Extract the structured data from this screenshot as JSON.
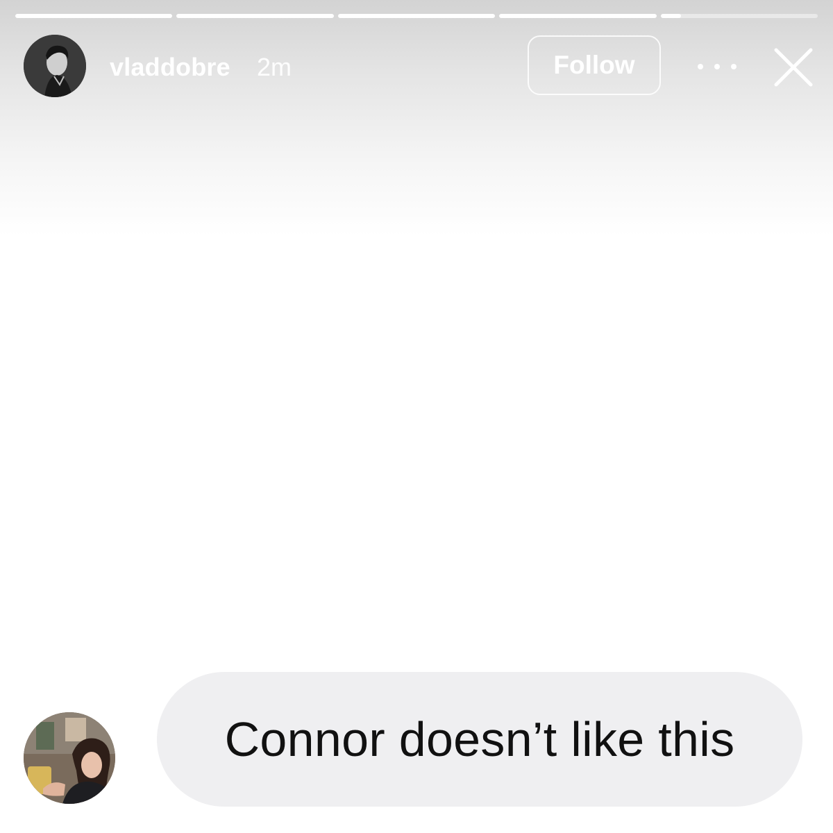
{
  "story": {
    "progress": {
      "segments": [
        1,
        1,
        1,
        1,
        0.13
      ]
    },
    "header": {
      "username": "vladdobre",
      "timestamp": "2m",
      "follow_label": "Follow",
      "more_icon": "more-horizontal-icon",
      "close_icon": "close-icon"
    },
    "reply": {
      "text": "Connor doesn’t like this"
    }
  },
  "colors": {
    "overlay_text": "#ffffff",
    "bubble": "#efeff1",
    "bubble_text": "#111111"
  }
}
